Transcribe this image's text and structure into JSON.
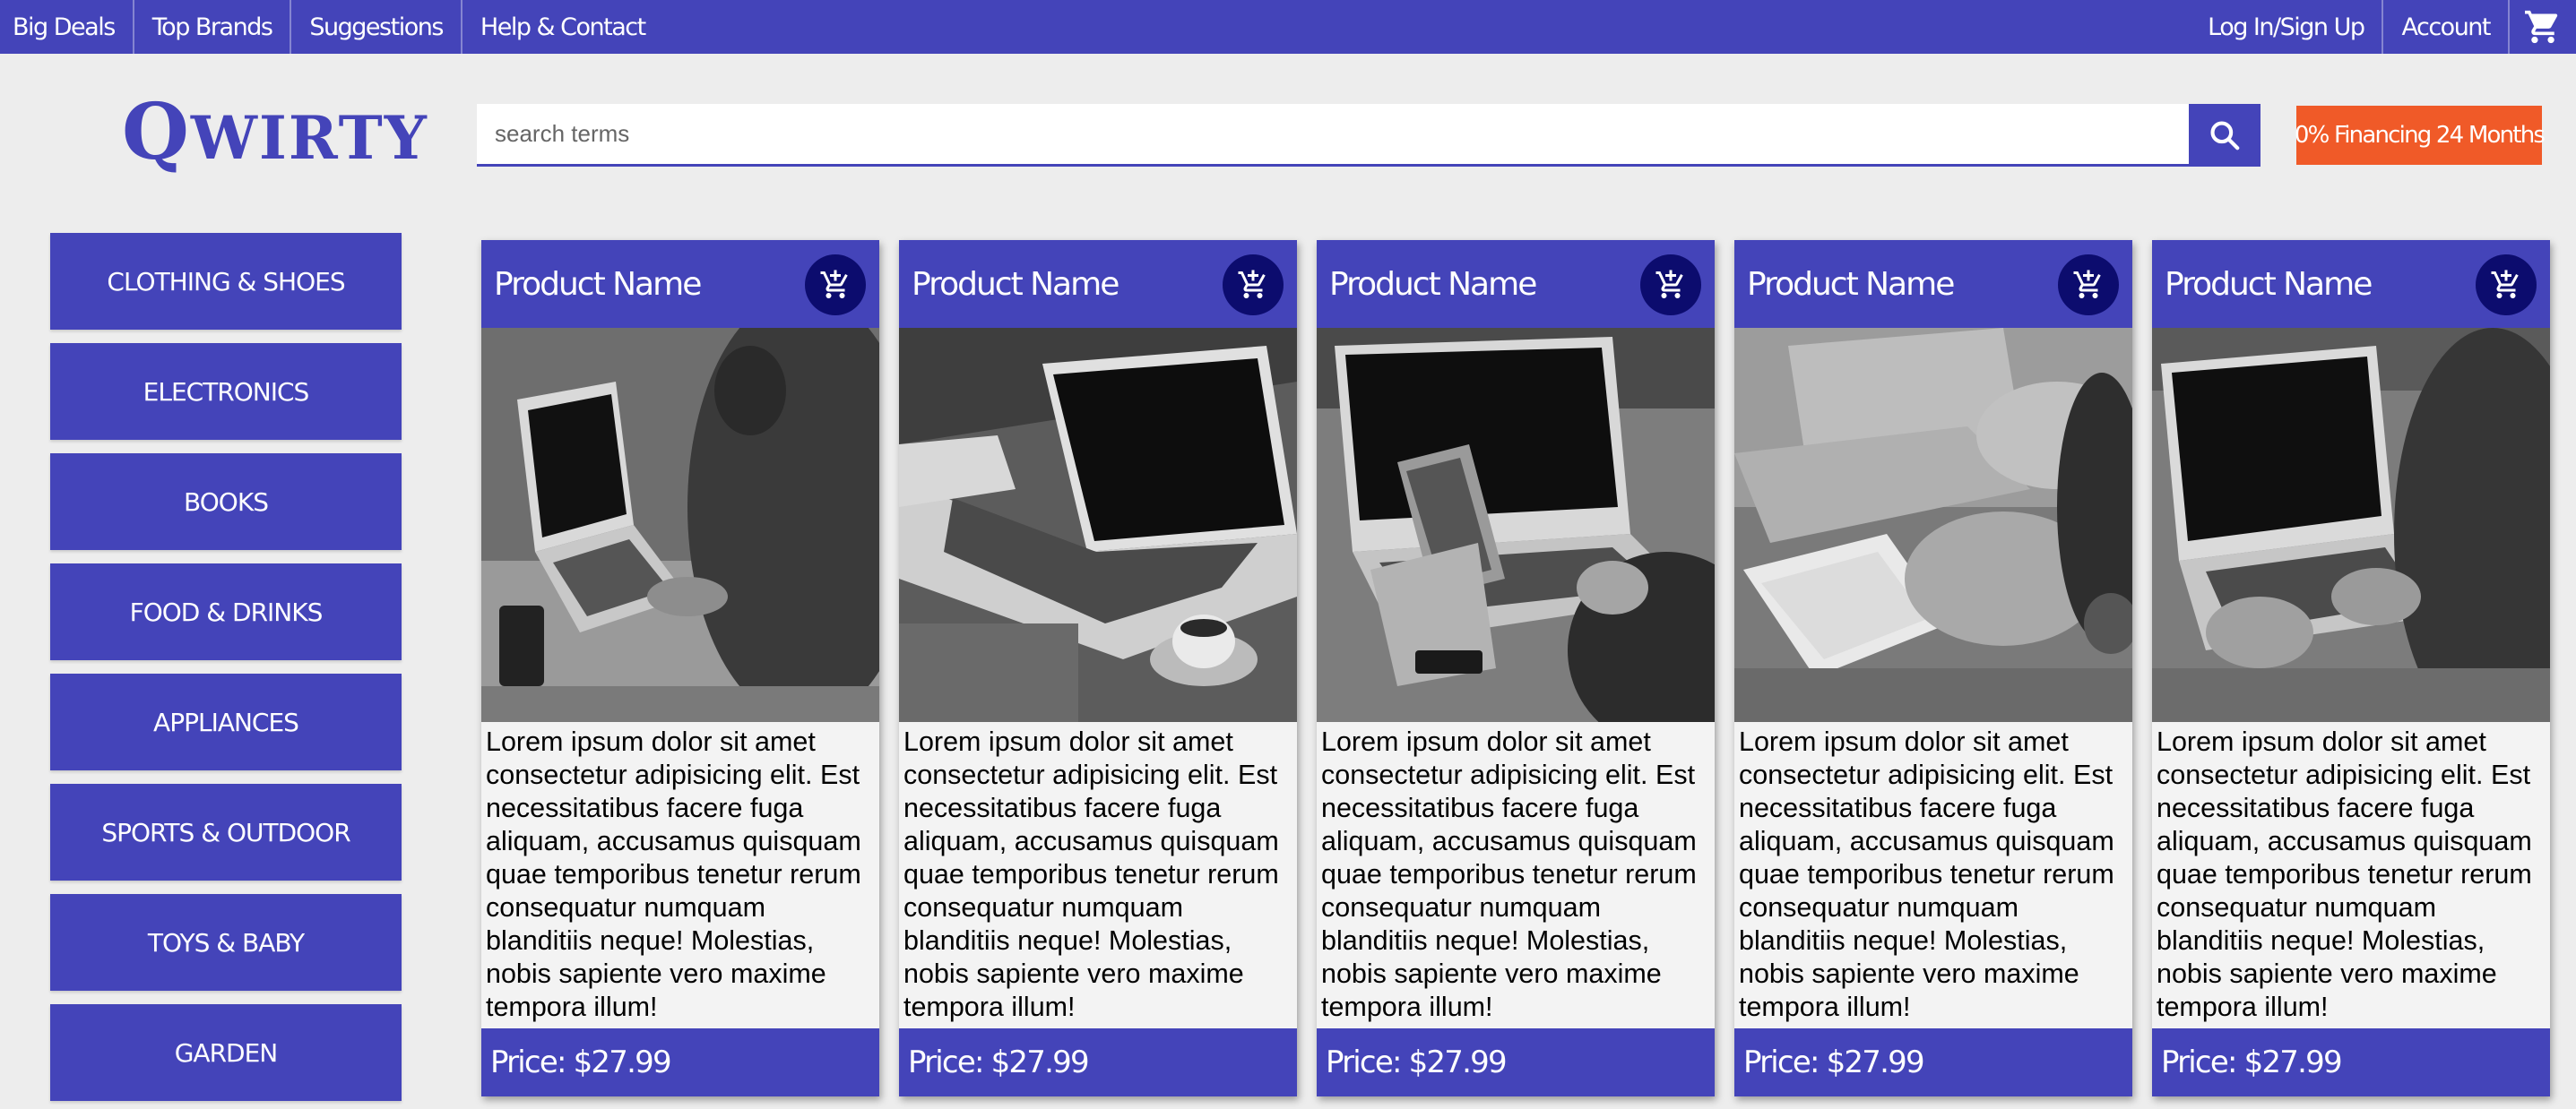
{
  "nav": {
    "left": [
      "Big Deals",
      "Top Brands",
      "Suggestions",
      "Help & Contact"
    ],
    "right": [
      "Log In/Sign Up",
      "Account"
    ],
    "cart_icon": "cart-icon"
  },
  "brand": {
    "logo_first": "Q",
    "logo_rest": "WIRTY"
  },
  "search": {
    "placeholder": "search terms",
    "button_icon": "search-icon"
  },
  "promo": "0% Financing 24 Months",
  "categories": [
    "CLOTHING & SHOES",
    "ELECTRONICS",
    "BOOKS",
    "FOOD & DRINKS",
    "APPLIANCES",
    "SPORTS & OUTDOOR",
    "TOYS & BABY",
    "GARDEN"
  ],
  "products": [
    {
      "name": "Product Name",
      "description": "Lorem ipsum dolor sit amet consectetur adipisicing elit. Est necessitatibus facere fuga aliquam, accusamus quisquam quae temporibus tenetur rerum consequatur numquam blanditiis neque! Molestias, nobis sapiente vero maxime tempora illum!",
      "price": "Price: $27.99",
      "image": "laptop-typing-photo"
    },
    {
      "name": "Product Name",
      "description": "Lorem ipsum dolor sit amet consectetur adipisicing elit. Est necessitatibus facere fuga aliquam, accusamus quisquam quae temporibus tenetur rerum consequatur numquam blanditiis neque! Molestias, nobis sapiente vero maxime tempora illum!",
      "price": "Price: $27.99",
      "image": "laptop-coffee-photo"
    },
    {
      "name": "Product Name",
      "description": "Lorem ipsum dolor sit amet consectetur adipisicing elit. Est necessitatibus facere fuga aliquam, accusamus quisquam quae temporibus tenetur rerum consequatur numquam blanditiis neque! Molestias, nobis sapiente vero maxime tempora illum!",
      "price": "Price: $27.99",
      "image": "laptop-phone-photo"
    },
    {
      "name": "Product Name",
      "description": "Lorem ipsum dolor sit amet consectetur adipisicing elit. Est necessitatibus facere fuga aliquam, accusamus quisquam quae temporibus tenetur rerum consequatur numquam blanditiis neque! Molestias, nobis sapiente vero maxime tempora illum!",
      "price": "Price: $27.99",
      "image": "hands-notebook-photo"
    },
    {
      "name": "Product Name",
      "description": "Lorem ipsum dolor sit amet consectetur adipisicing elit. Est necessitatibus facere fuga aliquam, accusamus quisquam quae temporibus tenetur rerum consequatur numquam blanditiis neque! Molestias, nobis sapiente vero maxime tempora illum!",
      "price": "Price: $27.99",
      "image": "laptop-typing-photo-2"
    }
  ],
  "colors": {
    "primary": "#4444b9",
    "promo": "#f05a28",
    "cart_badge": "#0c0c6e",
    "background": "#ededed"
  }
}
